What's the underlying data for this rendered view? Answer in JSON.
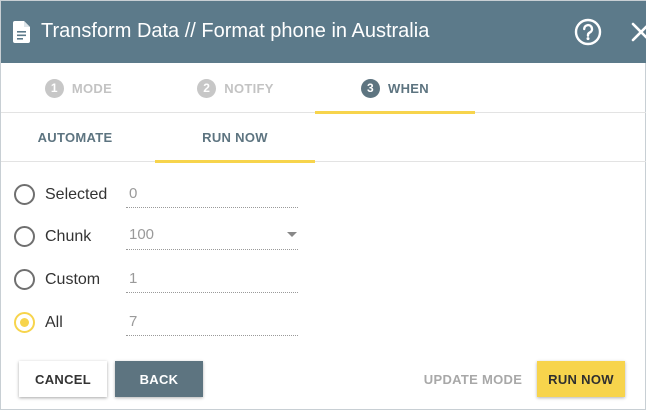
{
  "header": {
    "title": "Transform Data // Format phone in Australia",
    "icons": {
      "doc": "document-icon",
      "help": "help-circle-icon",
      "close": "close-icon"
    }
  },
  "steps": [
    {
      "number": "1",
      "label": "MODE",
      "state": "inactive"
    },
    {
      "number": "2",
      "label": "NOTIFY",
      "state": "inactive"
    },
    {
      "number": "3",
      "label": "WHEN",
      "state": "active"
    }
  ],
  "subtabs": [
    {
      "label": "AUTOMATE",
      "active": false
    },
    {
      "label": "RUN NOW",
      "active": true
    }
  ],
  "options": [
    {
      "label": "Selected",
      "value": "0",
      "checked": false
    },
    {
      "label": "Chunk",
      "value": "100",
      "checked": false,
      "type": "select"
    },
    {
      "label": "Custom",
      "value": "1",
      "checked": false
    },
    {
      "label": "All",
      "value": "7",
      "checked": true
    }
  ],
  "buttons": {
    "cancel": "CANCEL",
    "back": "BACK",
    "update_mode": "UPDATE MODE",
    "run_now": "RUN NOW"
  },
  "colors": {
    "header_bg": "#5c7a8a",
    "accent": "#f7d44c",
    "primary": "#5d7480"
  }
}
